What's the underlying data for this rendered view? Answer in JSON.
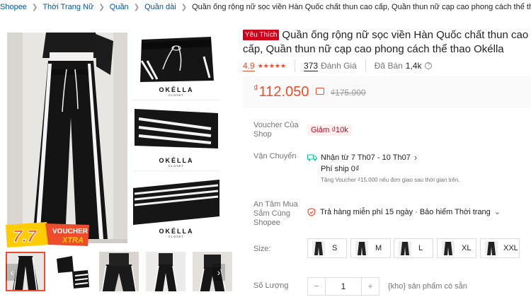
{
  "breadcrumb": {
    "items": [
      "Shopee",
      "Thời Trang Nữ",
      "Quần",
      "Quần dài"
    ],
    "current": "Quần ống rộng nữ sọc viền Hàn Quốc chất thun cao cấp, Quần thun nữ cạp cao phong cách thể thao Okélla"
  },
  "gallery": {
    "brand": "OKÉLLA",
    "brand_sub": "CLOSET",
    "promo_badge": {
      "big": "7.7",
      "line1": "VOUCHER",
      "line2": "XTRA"
    },
    "arrow_left": "‹",
    "arrow_right": "›"
  },
  "product": {
    "favorite_badge": "Yêu Thích",
    "title": "Quần ống rộng nữ sọc viền Hàn Quốc chất thun cao cấp, Quần thun nữ cạp cao phong cách thể thao Okélla",
    "rating": "4.9",
    "stars": "★★★★★",
    "reviews_count": "373",
    "reviews_label": "Đánh Giá",
    "sold_label": "Đã Bán",
    "sold_count": "1,4k",
    "help": "?"
  },
  "price": {
    "currency": "₫",
    "current": "112.050",
    "original": "₫175.000",
    "accent": "#ee4d2d"
  },
  "voucher": {
    "label": "Voucher Của Shop",
    "chip": "Giảm ₫10k"
  },
  "shipping": {
    "label": "Vận Chuyển",
    "receive": "Nhận từ 7 Th07 - 10 Th07",
    "chevron": "›",
    "fee": "Phí ship 0₫",
    "note": "Tặng Voucher ₫15.000 nếu đơn giao sau thời gian trên."
  },
  "guarantee": {
    "label": "An Tâm Mua Sắm Cùng Shopee",
    "text": "Trả hàng miễn phí 15 ngày · Bảo hiểm Thời trang",
    "chevron": "⌄"
  },
  "size": {
    "label": "Size:",
    "options": [
      "S",
      "M",
      "L",
      "XL",
      "XXL"
    ]
  },
  "quantity": {
    "label": "Số Lượng",
    "minus": "−",
    "value": "1",
    "plus": "+",
    "stock": "{kho} sản phẩm có sẵn"
  }
}
